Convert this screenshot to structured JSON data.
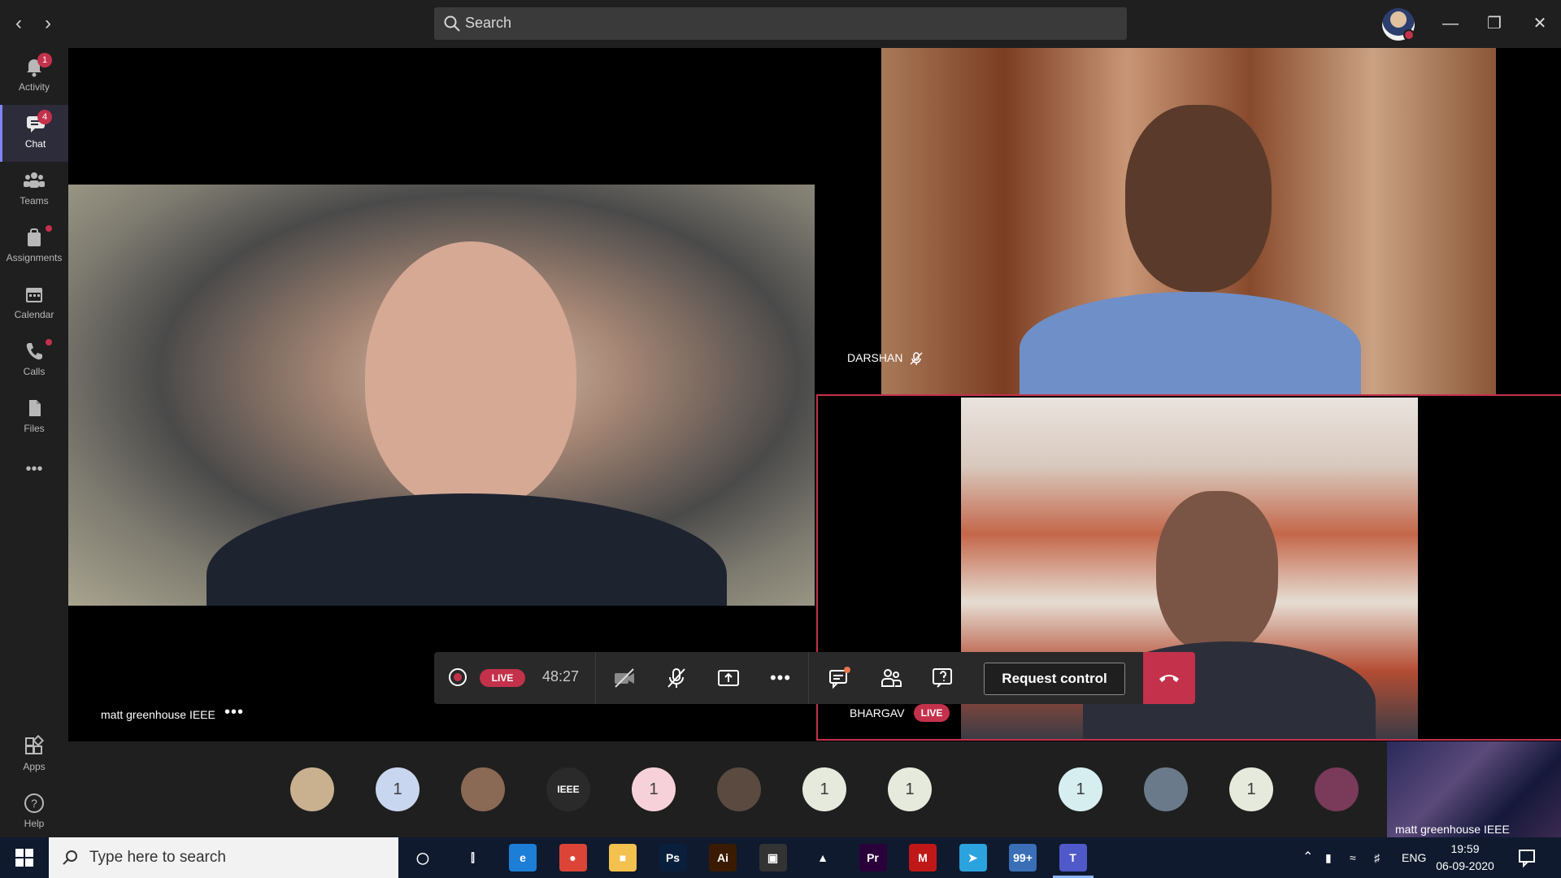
{
  "titlebar": {
    "search_placeholder": "Search",
    "minimize": "—",
    "restore": "❐",
    "close": "✕"
  },
  "rail": {
    "items": [
      {
        "label": "Activity",
        "icon": "bell-icon",
        "badge": "1"
      },
      {
        "label": "Chat",
        "icon": "chat-icon",
        "badge": "4"
      },
      {
        "label": "Teams",
        "icon": "teams-icon"
      },
      {
        "label": "Assignments",
        "icon": "assignments-icon"
      },
      {
        "label": "Calendar",
        "icon": "calendar-icon"
      },
      {
        "label": "Calls",
        "icon": "phone-icon"
      },
      {
        "label": "Files",
        "icon": "files-icon"
      }
    ],
    "more": "•••",
    "apps_label": "Apps",
    "help_label": "Help"
  },
  "participants": {
    "main": {
      "name": "matt greenhouse IEEE",
      "more": "•••"
    },
    "darshan": {
      "name": "DARSHAN"
    },
    "bhargav": {
      "name": "BHARGAV",
      "live": "LIVE"
    }
  },
  "controls": {
    "live_label": "LIVE",
    "timer": "48:27",
    "more": "•••",
    "request_control": "Request control"
  },
  "gallery": {
    "avatars": [
      {
        "kind": "photo",
        "color": "#c9b08f"
      },
      {
        "kind": "count",
        "text": "1",
        "color": "#c9d6ef"
      },
      {
        "kind": "photo",
        "color": "#8a6a55"
      },
      {
        "kind": "logo",
        "text": "IEEE",
        "color": "#2a2a2a"
      },
      {
        "kind": "count",
        "text": "1",
        "color": "#f7d1da"
      },
      {
        "kind": "photo",
        "color": "#5a4a40"
      },
      {
        "kind": "count",
        "text": "1",
        "color": "#e6eadc"
      },
      {
        "kind": "count",
        "text": "1",
        "color": "#e6eadc"
      },
      {
        "kind": "logo",
        "text": "",
        "color": "#1f1f1f"
      },
      {
        "kind": "count",
        "text": "1",
        "color": "#d6eef0"
      },
      {
        "kind": "photo",
        "color": "#6a7a8a"
      },
      {
        "kind": "count",
        "text": "1",
        "color": "#e6eadc"
      },
      {
        "kind": "photo",
        "color": "#7a3a5a"
      }
    ],
    "thumb_label": "matt greenhouse IEEE"
  },
  "taskbar": {
    "search_placeholder": "Type here to search",
    "apps": [
      {
        "name": "cortana",
        "label": "◯",
        "color": "transparent"
      },
      {
        "name": "task-view",
        "label": "⫿",
        "color": "transparent"
      },
      {
        "name": "edge",
        "label": "e",
        "color": "#1c7ed6"
      },
      {
        "name": "chrome",
        "label": "●",
        "color": "#db4437"
      },
      {
        "name": "file-explorer",
        "label": "■",
        "color": "#f2c14e"
      },
      {
        "name": "photoshop",
        "label": "Ps",
        "color": "#0a1f3c"
      },
      {
        "name": "illustrator",
        "label": "Ai",
        "color": "#3a1a00"
      },
      {
        "name": "store",
        "label": "▣",
        "color": "#333333"
      },
      {
        "name": "vlc",
        "label": "▲",
        "color": "transparent"
      },
      {
        "name": "premiere",
        "label": "Pr",
        "color": "#2a003a"
      },
      {
        "name": "mcafee",
        "label": "M",
        "color": "#c01818"
      },
      {
        "name": "telegram",
        "label": "➤",
        "color": "#2aa3de"
      },
      {
        "name": "files-app",
        "label": "99+",
        "color": "#3a6fb8"
      },
      {
        "name": "teams",
        "label": "T",
        "color": "#5059c9"
      }
    ],
    "lang": "ENG",
    "time": "19:59",
    "date": "06-09-2020"
  }
}
